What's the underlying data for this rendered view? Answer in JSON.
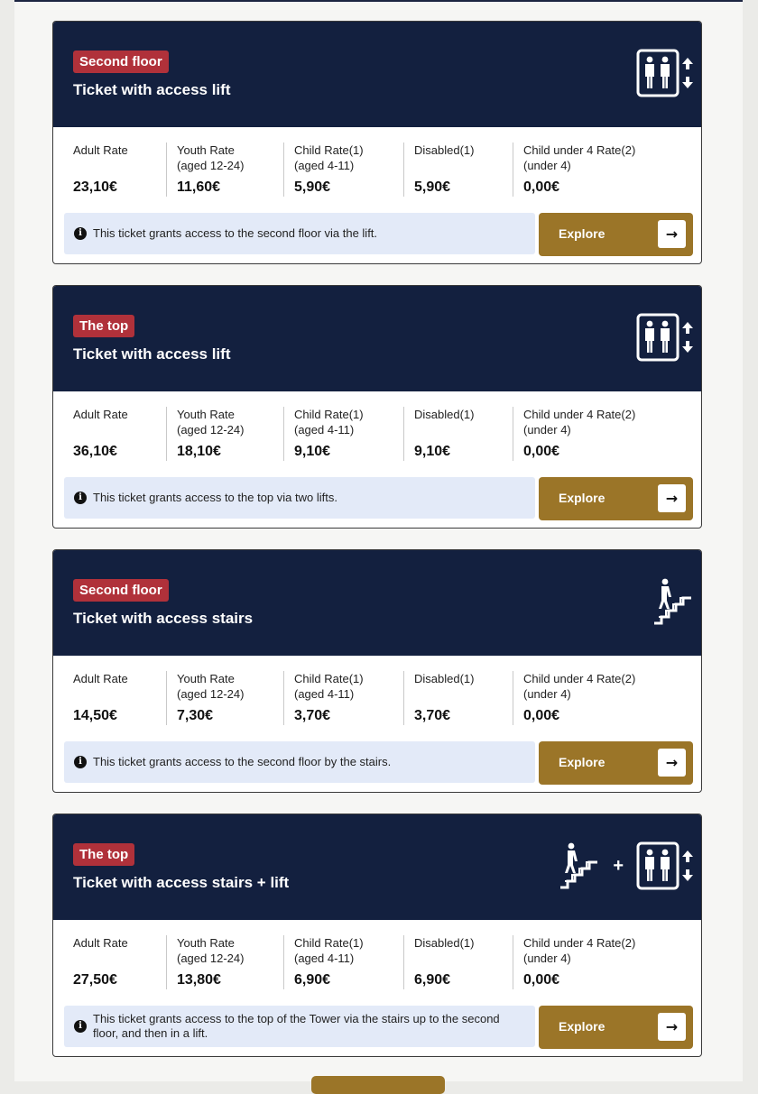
{
  "colors": {
    "header_navy": "#13203f",
    "badge_red": "#b0313a",
    "explore_gold": "#9b7528",
    "info_blue": "#e3eaf8"
  },
  "rate_labels": {
    "adult": "Adult Rate",
    "youth": "Youth Rate\n(aged 12-24)",
    "child": "Child Rate(1)\n(aged 4-11)",
    "disabled": "Disabled(1)",
    "under4": "Child under 4 Rate(2)\n(under 4)"
  },
  "explore_label": "Explore",
  "cards": [
    {
      "badge": "Second floor",
      "title": "Ticket with access lift",
      "icon": "lift-icon",
      "prices": {
        "adult": "23,10€",
        "youth": "11,60€",
        "child": "5,90€",
        "disabled": "5,90€",
        "under4": "0,00€"
      },
      "info": "This ticket grants access to the second floor via the lift."
    },
    {
      "badge": "The top",
      "title": "Ticket with access lift",
      "icon": "lift-icon",
      "prices": {
        "adult": "36,10€",
        "youth": "18,10€",
        "child": "9,10€",
        "disabled": "9,10€",
        "under4": "0,00€"
      },
      "info": "This ticket grants access to the top via two lifts."
    },
    {
      "badge": "Second floor",
      "title": "Ticket with access stairs",
      "icon": "stairs-icon",
      "prices": {
        "adult": "14,50€",
        "youth": "7,30€",
        "child": "3,70€",
        "disabled": "3,70€",
        "under4": "0,00€"
      },
      "info": "This ticket grants access to the second floor by the stairs."
    },
    {
      "badge": "The top",
      "title": "Ticket with access stairs + lift",
      "icon": "stairs-plus-lift-icon",
      "plus_sign": "+",
      "prices": {
        "adult": "27,50€",
        "youth": "13,80€",
        "child": "6,90€",
        "disabled": "6,90€",
        "under4": "0,00€"
      },
      "info": "This ticket grants access to the top of the Tower via the stairs up to the second floor, and then in a lift."
    }
  ]
}
